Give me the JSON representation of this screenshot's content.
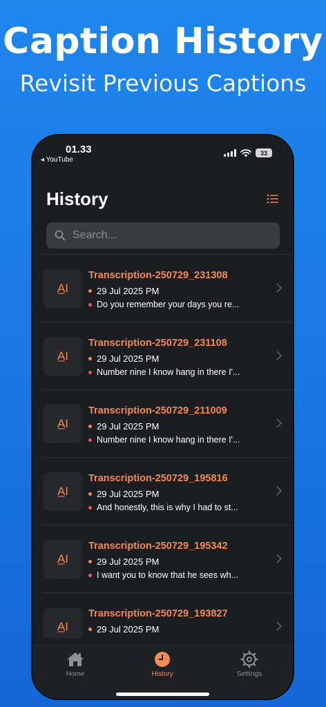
{
  "promo": {
    "title": "Caption History",
    "subtitle": "Revisit Previous Captions"
  },
  "status_bar": {
    "time": "01.33",
    "back_app": "◂ YouTube",
    "battery": "33"
  },
  "header": {
    "title": "History",
    "menu_icon": "list-icon"
  },
  "search": {
    "placeholder": "Search..."
  },
  "items": [
    {
      "title": "Transcription-250729_231308",
      "date": "29 Jul 2025 PM",
      "snippet": "Do you remember your days you re..."
    },
    {
      "title": "Transcription-250729_231108",
      "date": "29 Jul 2025 PM",
      "snippet": "Number nine I know hang in there I'..."
    },
    {
      "title": "Transcription-250729_211009",
      "date": "29 Jul 2025 PM",
      "snippet": "Number nine I know hang in there I'..."
    },
    {
      "title": "Transcription-250729_195816",
      "date": "29 Jul 2025 PM",
      "snippet": "And honestly, this is why I had to st..."
    },
    {
      "title": "Transcription-250729_195342",
      "date": "29 Jul 2025 PM",
      "snippet": "I want you to know that he sees wh..."
    },
    {
      "title": "Transcription-250729_193827",
      "date": "29 Jul 2025 PM",
      "snippet": ""
    }
  ],
  "thumb_glyph": "A̲I",
  "tabs": [
    {
      "label": "Home",
      "icon": "home-icon"
    },
    {
      "label": "History",
      "icon": "clock-icon",
      "active": true
    },
    {
      "label": "Settings",
      "icon": "gear-icon"
    }
  ],
  "colors": {
    "background": "#1a76e3",
    "accent": "#f08a57",
    "snippet_dot": "#e05b5b",
    "panel": "#1c1d20"
  }
}
